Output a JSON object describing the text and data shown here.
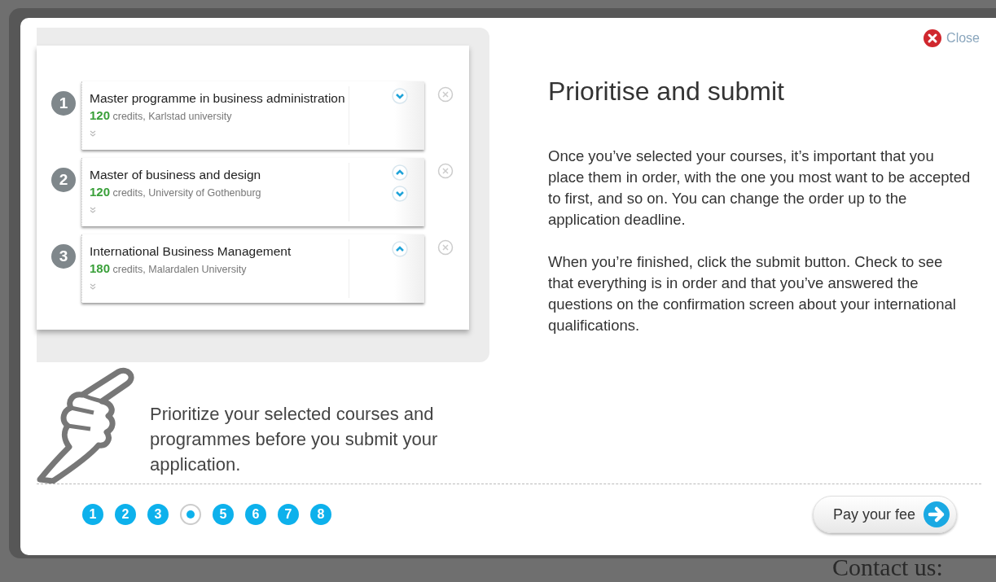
{
  "background": {
    "heading": "Contact us:"
  },
  "dialog": {
    "close": {
      "label": "Close"
    },
    "illustration": {
      "courses": [
        {
          "number": "1",
          "title": "Master programme in business administration",
          "credits": "120",
          "detail": "credits, Karlstad university",
          "can_move_up": false,
          "can_move_down": true
        },
        {
          "number": "2",
          "title": "Master of business and design",
          "credits": "120",
          "detail": "credits, University of Gothenburg",
          "can_move_up": true,
          "can_move_down": true
        },
        {
          "number": "3",
          "title": "International Business Management",
          "credits": "180",
          "detail": "credits, Malardalen University",
          "can_move_up": true,
          "can_move_down": false
        }
      ],
      "caption": "Prioritize your selected courses and programmes before you submit your application."
    },
    "title": "Prioritise and submit",
    "paragraphs": [
      "Once you’ve selected your courses, it’s important that you place them in order, with the one you most want to be accepted to first, and so on. You can change the order up to the application deadline.",
      "When you’re finished, click the submit button. Check to see that everything is in order and that you’ve answered the questions on the confirmation screen about your international qualifications."
    ],
    "pager": [
      {
        "label": "1",
        "selected": false
      },
      {
        "label": "2",
        "selected": false
      },
      {
        "label": "3",
        "selected": false
      },
      {
        "selected": true
      },
      {
        "label": "5",
        "selected": false
      },
      {
        "label": "6",
        "selected": false
      },
      {
        "label": "7",
        "selected": false
      },
      {
        "label": "8",
        "selected": false
      }
    ],
    "next_button": {
      "label": "Pay your fee"
    }
  }
}
